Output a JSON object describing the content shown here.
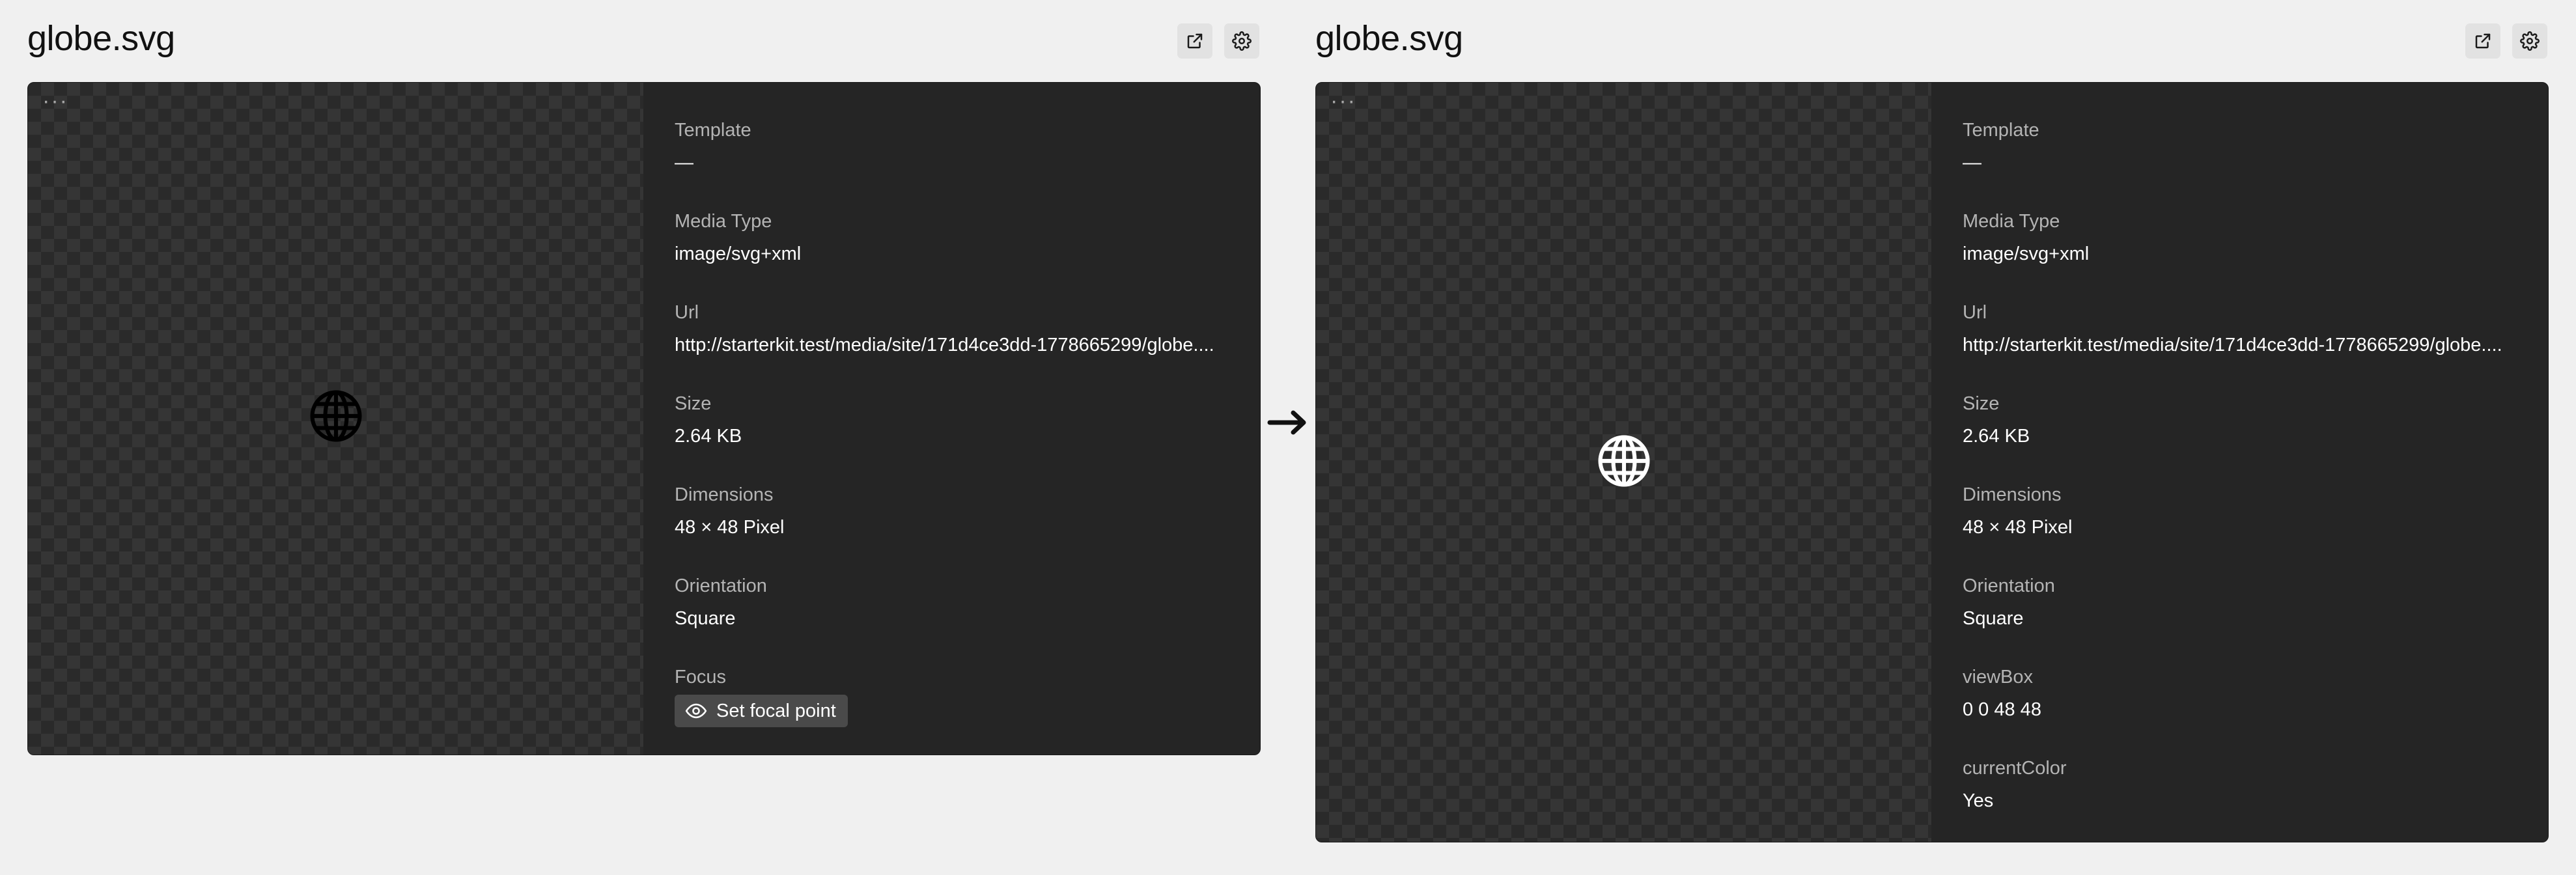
{
  "left": {
    "title": "globe.svg",
    "open_icon": "external-link-icon",
    "settings_icon": "gear-icon",
    "menu_dots": "···",
    "globe_color": "#000000",
    "fields": [
      {
        "label": "Template",
        "value": "—"
      },
      {
        "label": "Media Type",
        "value": "image/svg+xml"
      },
      {
        "label": "Url",
        "value": "http://starterkit.test/media/site/171d4ce3dd-1778665299/globe...."
      },
      {
        "label": "Size",
        "value": "2.64 KB"
      },
      {
        "label": "Dimensions",
        "value": "48 × 48 Pixel"
      },
      {
        "label": "Orientation",
        "value": "Square"
      },
      {
        "label": "Focus",
        "button": "Set focal point"
      }
    ]
  },
  "arrow": "→",
  "right": {
    "title": "globe.svg",
    "open_icon": "external-link-icon",
    "settings_icon": "gear-icon",
    "menu_dots": "···",
    "globe_color": "#ffffff",
    "fields": [
      {
        "label": "Template",
        "value": "—"
      },
      {
        "label": "Media Type",
        "value": "image/svg+xml"
      },
      {
        "label": "Url",
        "value": "http://starterkit.test/media/site/171d4ce3dd-1778665299/globe...."
      },
      {
        "label": "Size",
        "value": "2.64 KB"
      },
      {
        "label": "Dimensions",
        "value": "48 × 48 Pixel"
      },
      {
        "label": "Orientation",
        "value": "Square"
      },
      {
        "label": "viewBox",
        "value": "0 0 48 48"
      },
      {
        "label": "currentColor",
        "value": "Yes"
      }
    ]
  },
  "colors": {
    "page_bg": "#f0f0f0",
    "card_bg": "#252525",
    "label": "#b4b4b4",
    "value": "#ffffff"
  }
}
